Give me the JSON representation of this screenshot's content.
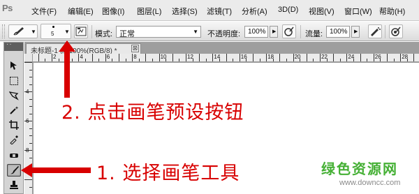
{
  "app": {
    "logo": "Ps"
  },
  "menu": [
    {
      "label": "文件(F)"
    },
    {
      "label": "编辑(E)"
    },
    {
      "label": "图像(I)"
    },
    {
      "label": "图层(L)"
    },
    {
      "label": "选择(S)"
    },
    {
      "label": "滤镜(T)"
    },
    {
      "label": "分析(A)"
    },
    {
      "label": "3D(D)"
    },
    {
      "label": "视图(V)"
    },
    {
      "label": "窗口(W)"
    },
    {
      "label": "帮助(H)"
    }
  ],
  "options_bar": {
    "brush_size": "5",
    "mode_label": "模式:",
    "mode_value": "正常",
    "opacity_label": "不透明度:",
    "opacity_value": "100%",
    "flow_label": "流量:",
    "flow_value": "100%"
  },
  "document": {
    "tab_title": "未标题-1 @ 100%(RGB/8) *",
    "close_glyph": "⊠",
    "ruler_h_labels": [
      "2",
      "4",
      "6",
      "8",
      "10",
      "12",
      "14",
      "16",
      "18",
      "20",
      "22",
      "24",
      "26",
      "28"
    ],
    "ruler_v_labels": [
      "4",
      "6",
      "8"
    ]
  },
  "annotations": {
    "step2": "2. 点击画笔预设按钮",
    "step1": "1. 选择画笔工具"
  },
  "watermark": {
    "logo": "绿色资源网",
    "url": "www.downcc.com"
  },
  "colors": {
    "annotation": "#d80000",
    "watermark_logo": "#45b035"
  }
}
